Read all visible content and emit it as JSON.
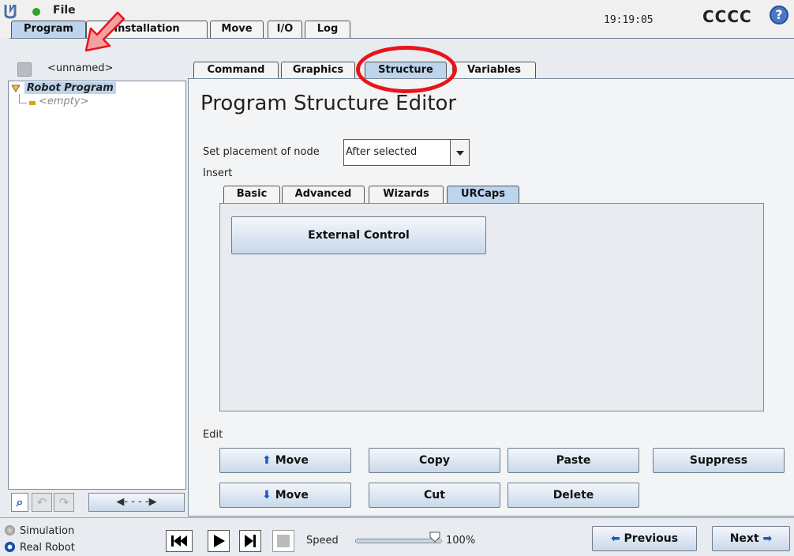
{
  "app": {
    "file_label": "File",
    "time": "19:19:05",
    "robot_name": "CCCC",
    "help_icon": "question-mark-icon"
  },
  "main_tabs": [
    "Program",
    "Installation",
    "Move",
    "I/O",
    "Log"
  ],
  "program_name": "<unnamed>",
  "tree": {
    "root_label": "Robot Program",
    "child_label": "<empty>"
  },
  "sub_tabs": [
    "Command",
    "Graphics",
    "Structure",
    "Variables"
  ],
  "editor": {
    "title": "Program Structure Editor",
    "placement_label": "Set placement of node",
    "placement_value": "After selected",
    "insert_label": "Insert",
    "insert_tabs": [
      "Basic",
      "Advanced",
      "Wizards",
      "URCaps"
    ],
    "urcap_button": "External Control",
    "edit_label": "Edit",
    "edit_buttons": {
      "move_up": "Move",
      "move_down": "Move",
      "copy": "Copy",
      "paste": "Paste",
      "suppress": "Suppress",
      "cut": "Cut",
      "delete": "Delete"
    }
  },
  "footer": {
    "simulation_label": "Simulation",
    "real_robot_label": "Real Robot",
    "speed_label": "Speed",
    "speed_value": "100%",
    "speed_fraction": 1.0,
    "previous_label": "Previous",
    "next_label": "Next"
  },
  "colors": {
    "accent_blue": "#bcd4ec",
    "annotation_red": "#e8141c",
    "arrow_fill": "#f4a0a0"
  }
}
